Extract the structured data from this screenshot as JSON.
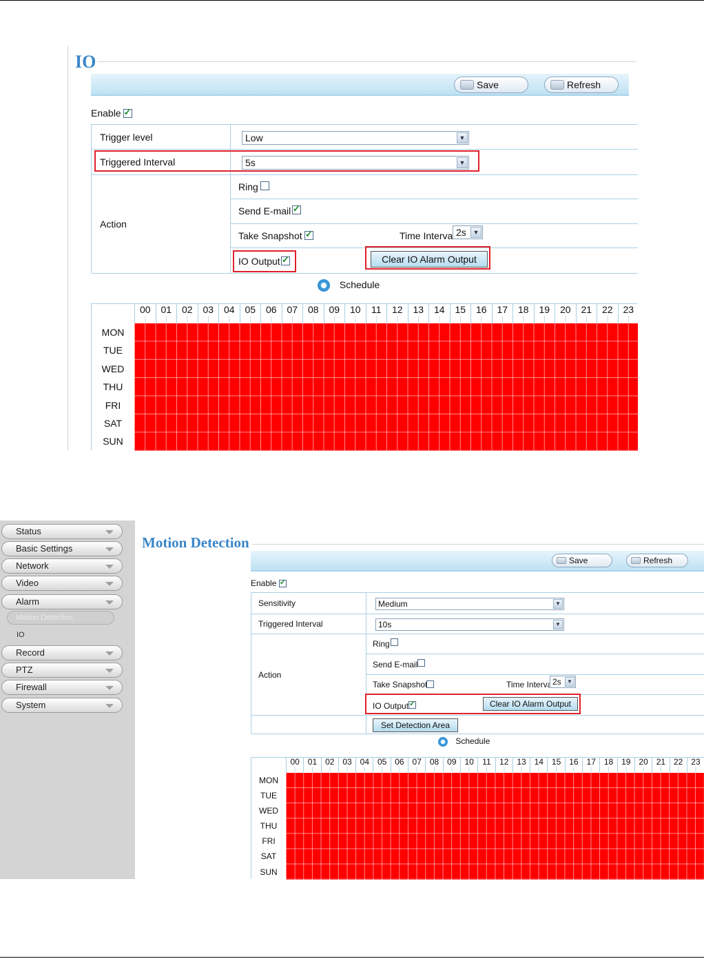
{
  "io_panel": {
    "title": "IO",
    "save_label": "Save",
    "refresh_label": "Refresh",
    "enable_label": "Enable",
    "enable_checked": true,
    "trigger_level_label": "Trigger level",
    "trigger_level_value": "Low",
    "triggered_interval_label": "Triggered Interval",
    "triggered_interval_value": "5s",
    "action_label": "Action",
    "ring_label": "Ring",
    "ring_checked": false,
    "send_email_label": "Send E-mail",
    "send_email_checked": true,
    "take_snapshot_label": "Take Snapshot",
    "take_snapshot_checked": true,
    "time_interval_label": "Time Interval",
    "time_interval_value": "2s",
    "io_output_label": "IO Output",
    "io_output_checked": true,
    "clear_alarm_label": "Clear IO Alarm Output",
    "schedule_label": "Schedule"
  },
  "motion_panel": {
    "title": "Motion Detection",
    "save_label": "Save",
    "refresh_label": "Refresh",
    "enable_label": "Enable",
    "enable_checked": true,
    "sensitivity_label": "Sensitivity",
    "sensitivity_value": "Medium",
    "triggered_interval_label": "Triggered Interval",
    "triggered_interval_value": "10s",
    "action_label": "Action",
    "ring_label": "Ring",
    "ring_checked": false,
    "send_email_label": "Send E-mail",
    "send_email_checked": false,
    "take_snapshot_label": "Take Snapshot",
    "take_snapshot_checked": false,
    "time_interval_label": "Time Interval",
    "time_interval_value": "2s",
    "io_output_label": "IO Output",
    "io_output_checked": true,
    "clear_alarm_label": "Clear IO Alarm Output",
    "set_area_label": "Set Detection Area",
    "schedule_label": "Schedule"
  },
  "sidebar": {
    "items": [
      {
        "label": "Status"
      },
      {
        "label": "Basic Settings"
      },
      {
        "label": "Network"
      },
      {
        "label": "Video"
      },
      {
        "label": "Alarm"
      },
      {
        "label": "Record"
      },
      {
        "label": "PTZ"
      },
      {
        "label": "Firewall"
      },
      {
        "label": "System"
      }
    ],
    "sub_items": [
      {
        "label": "Motion Detection",
        "active": true
      },
      {
        "label": "IO",
        "active": false
      }
    ]
  },
  "schedule": {
    "hours": [
      "00",
      "01",
      "02",
      "03",
      "04",
      "05",
      "06",
      "07",
      "08",
      "09",
      "10",
      "11",
      "12",
      "13",
      "14",
      "15",
      "16",
      "17",
      "18",
      "19",
      "20",
      "21",
      "22",
      "23"
    ],
    "days": [
      "MON",
      "TUE",
      "WED",
      "THU",
      "FRI",
      "SAT",
      "SUN"
    ],
    "all_selected": true,
    "selected_color": "#ff0000"
  },
  "colors": {
    "accent": "#3a86c8",
    "highlight": "#e0202a"
  }
}
